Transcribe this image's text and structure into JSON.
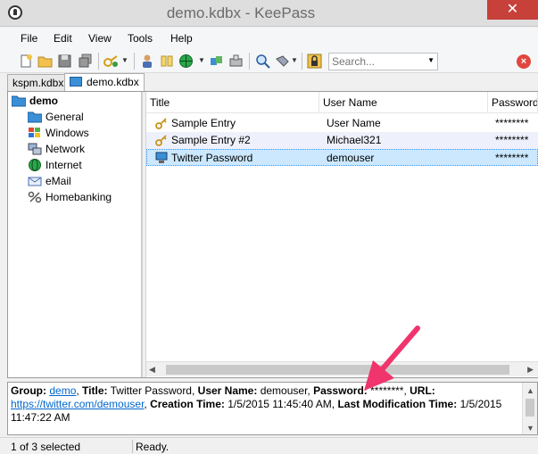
{
  "window": {
    "title": "demo.kdbx - KeePass",
    "close_glyph": "✕"
  },
  "menu": [
    "File",
    "Edit",
    "View",
    "Tools",
    "Help"
  ],
  "search": {
    "placeholder": "Search..."
  },
  "tabs": [
    {
      "label": "kspm.kdbx",
      "active": false
    },
    {
      "label": "demo.kdbx",
      "active": true
    }
  ],
  "tree": {
    "root": {
      "label": "demo",
      "icon": "folder-open-icon"
    },
    "groups": [
      {
        "label": "General",
        "icon": "folder-icon"
      },
      {
        "label": "Windows",
        "icon": "windows-logo-icon"
      },
      {
        "label": "Network",
        "icon": "network-icon"
      },
      {
        "label": "Internet",
        "icon": "globe-icon"
      },
      {
        "label": "eMail",
        "icon": "envelope-icon"
      },
      {
        "label": "Homebanking",
        "icon": "percent-icon"
      }
    ]
  },
  "columns": [
    "Title",
    "User Name",
    "Password"
  ],
  "entries": [
    {
      "title": "Sample Entry",
      "username": "User Name",
      "password": "********",
      "icon": "key-icon"
    },
    {
      "title": "Sample Entry #2",
      "username": "Michael321",
      "password": "********",
      "icon": "key-icon"
    },
    {
      "title": "Twitter Password",
      "username": "demouser",
      "password": "********",
      "icon": "computer-icon",
      "selected": true
    }
  ],
  "details": {
    "group_label": "Group:",
    "group_value": "demo",
    "title_label": "Title:",
    "title_value": "Twitter Password",
    "username_label": "User Name:",
    "username_value": "demouser",
    "password_label": "Password:",
    "password_value": "********",
    "url_label": "URL:",
    "url_value": "https://twitter.com/demouser",
    "creation_label": "Creation Time:",
    "creation_value": "1/5/2015 11:45:40 AM",
    "modification_label": "Last Modification Time:",
    "modification_value": "1/5/2015 11:47:22 AM"
  },
  "status": {
    "selection": "1 of 3 selected",
    "state": "Ready."
  },
  "colors": {
    "accent": "#3399ff",
    "arrow": "#f0346c",
    "link": "#0066cc"
  }
}
